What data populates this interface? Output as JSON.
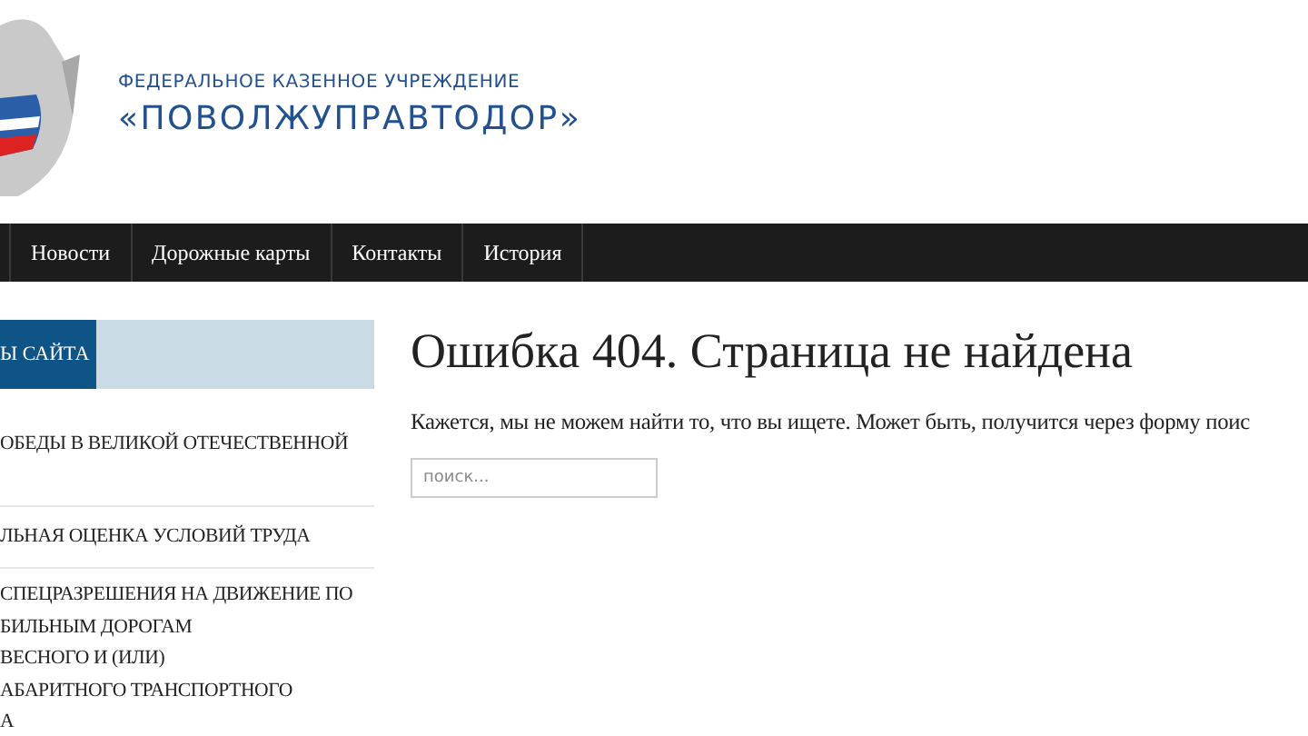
{
  "header": {
    "subtitle": "ФЕДЕРАЛЬНОЕ КАЗЕННОЕ УЧРЕЖДЕНИЕ",
    "title": "«ПОВОЛЖУПРАВТОДОР»"
  },
  "nav": {
    "items": [
      "Новости",
      "Дорожные карты",
      "Контакты",
      "История"
    ]
  },
  "sidebar": {
    "tab": "Ы САЙТА",
    "items": [
      "ОБЕДЫ В ВЕЛИКОЙ ОТЕЧЕСТВЕННОЙ",
      "ЛЬНАЯ ОЦЕНКА УСЛОВИЙ ТРУДА",
      "СПЕЦРАЗРЕШЕНИЯ НА ДВИЖЕНИЕ ПО\nБИЛЬНЫМ ДОРОГАМ\nВЕСНОГО И (ИЛИ)\nАБАРИТНОГО ТРАНСПОРТНОГО\nА"
    ]
  },
  "content": {
    "heading": "Ошибка 404. Страница не найдена",
    "message": "Кажется, мы не можем найти то, что вы ищете. Может быть, получится через форму поис",
    "search": {
      "placeholder": "поиск..."
    }
  }
}
